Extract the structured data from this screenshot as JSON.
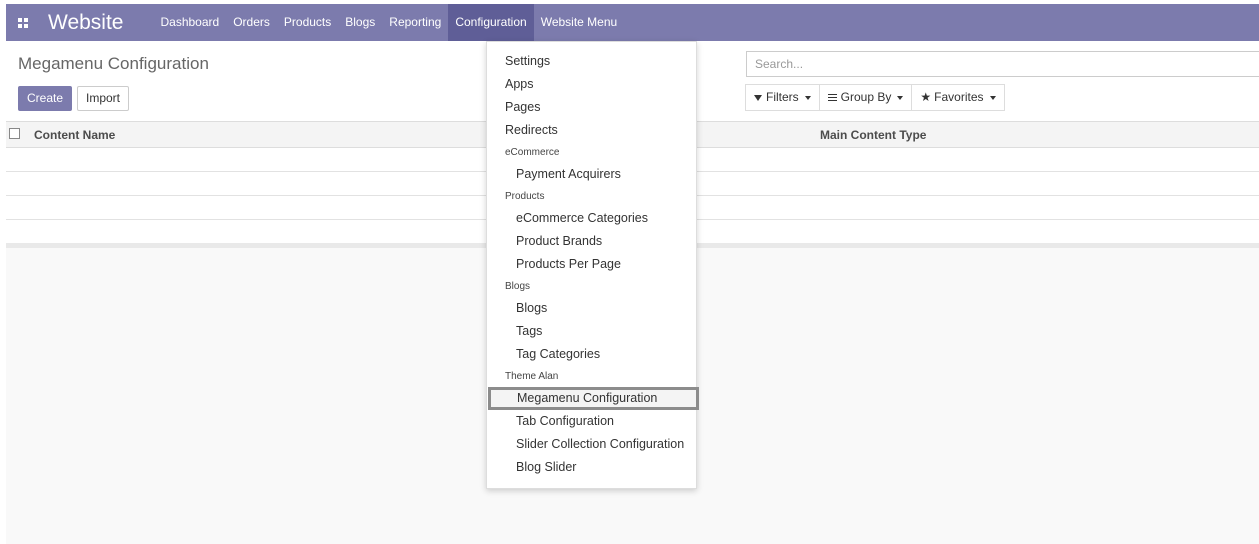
{
  "topbar": {
    "brand": "Website",
    "nav": [
      "Dashboard",
      "Orders",
      "Products",
      "Blogs",
      "Reporting",
      "Configuration",
      "Website Menu"
    ],
    "active": "Configuration"
  },
  "control_panel": {
    "breadcrumb": "Megamenu Configuration",
    "create_label": "Create",
    "import_label": "Import",
    "search_placeholder": "Search...",
    "filters_label": "Filters",
    "groupby_label": "Group By",
    "favorites_label": "Favorites"
  },
  "list": {
    "columns": [
      "Content Name",
      "Main Content Type"
    ]
  },
  "dropdown": {
    "items": [
      {
        "type": "item",
        "label": "Settings"
      },
      {
        "type": "item",
        "label": "Apps"
      },
      {
        "type": "item",
        "label": "Pages"
      },
      {
        "type": "item",
        "label": "Redirects"
      },
      {
        "type": "header",
        "label": "eCommerce"
      },
      {
        "type": "sub",
        "label": "Payment Acquirers"
      },
      {
        "type": "header",
        "label": "Products"
      },
      {
        "type": "sub",
        "label": "eCommerce Categories"
      },
      {
        "type": "sub",
        "label": "Product Brands"
      },
      {
        "type": "sub",
        "label": "Products Per Page"
      },
      {
        "type": "header",
        "label": "Blogs"
      },
      {
        "type": "sub",
        "label": "Blogs"
      },
      {
        "type": "sub",
        "label": "Tags"
      },
      {
        "type": "sub",
        "label": "Tag Categories"
      },
      {
        "type": "header",
        "label": "Theme Alan"
      },
      {
        "type": "sub",
        "label": "Megamenu Configuration",
        "highlight": true
      },
      {
        "type": "sub",
        "label": "Tab Configuration"
      },
      {
        "type": "sub",
        "label": "Slider Collection Configuration"
      },
      {
        "type": "sub",
        "label": "Blog Slider"
      }
    ]
  },
  "colors": {
    "brand": "#7c7bad",
    "active_nav": "#5f5e97"
  }
}
